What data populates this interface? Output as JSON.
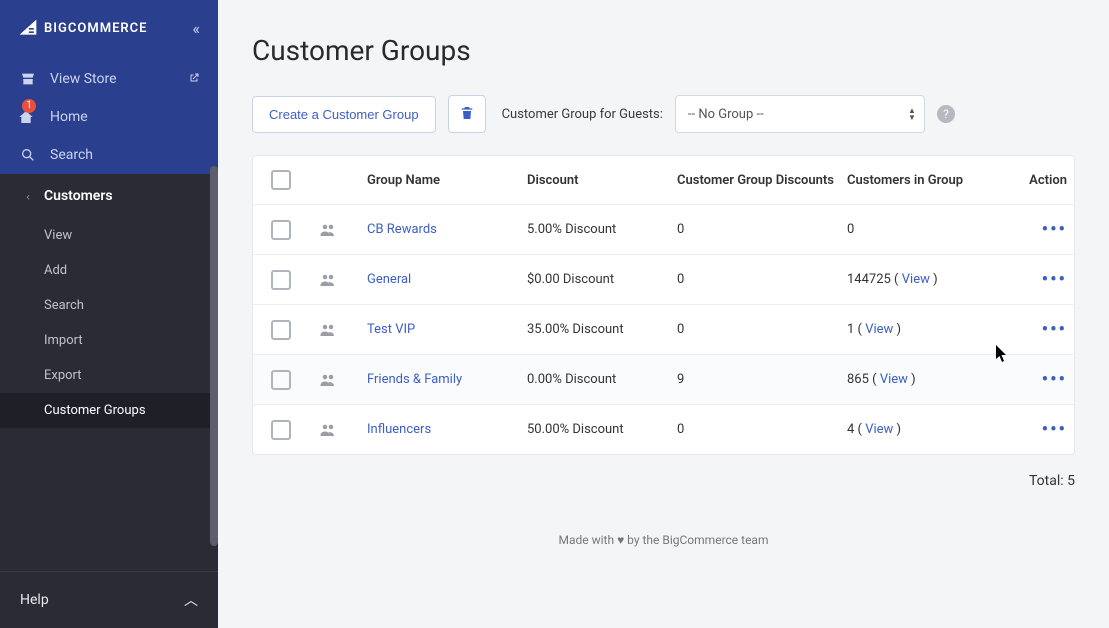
{
  "brand": {
    "name": "BIGCOMMERCE"
  },
  "sidebar": {
    "view_store": "View Store",
    "home": "Home",
    "home_badge": "1",
    "search": "Search",
    "section": "Customers",
    "items": [
      "View",
      "Add",
      "Search",
      "Import",
      "Export",
      "Customer Groups"
    ],
    "active_index": 5,
    "help": "Help"
  },
  "page": {
    "title": "Customer Groups",
    "create_btn": "Create a Customer Group",
    "guest_label": "Customer Group for Guests:",
    "guest_select": "-- No Group --"
  },
  "table": {
    "headers": {
      "group": "Group Name",
      "discount": "Discount",
      "cg_discounts": "Customer Group Discounts",
      "customers": "Customers in Group",
      "action": "Action"
    },
    "view_label": "View",
    "rows": [
      {
        "name": "CB Rewards",
        "discount": "5.00% Discount",
        "cg_discounts": "0",
        "customers_count": "0",
        "has_view": false
      },
      {
        "name": "General",
        "discount": "$0.00 Discount",
        "cg_discounts": "0",
        "customers_count": "144725",
        "has_view": true
      },
      {
        "name": "Test VIP",
        "discount": "35.00% Discount",
        "cg_discounts": "0",
        "customers_count": "1",
        "has_view": true
      },
      {
        "name": "Friends & Family",
        "discount": "0.00% Discount",
        "cg_discounts": "9",
        "customers_count": "865",
        "has_view": true,
        "hover": true
      },
      {
        "name": "Influencers",
        "discount": "50.00% Discount",
        "cg_discounts": "0",
        "customers_count": "4",
        "has_view": true
      }
    ]
  },
  "total": {
    "label": "Total",
    "value": "5"
  },
  "footer": {
    "prefix": "Made with ",
    "suffix": " by the BigCommerce team"
  }
}
